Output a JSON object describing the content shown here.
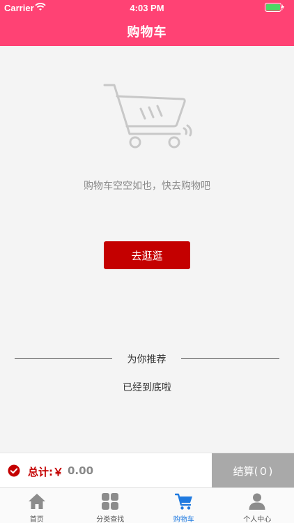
{
  "status_bar": {
    "carrier": "Carrier",
    "time": "4:03 PM"
  },
  "header": {
    "title": "购物车"
  },
  "empty_state": {
    "message": "购物车空空如也，快去购物吧",
    "button_label": "去逛逛"
  },
  "recommend": {
    "title": "为你推荐",
    "end_text": "已经到底啦"
  },
  "checkout": {
    "total_label": "总计:￥",
    "total_value": "0.00",
    "button_label": "结算(０)"
  },
  "tabs": [
    {
      "label": "首页",
      "icon": "home-icon"
    },
    {
      "label": "分类查找",
      "icon": "grid-icon"
    },
    {
      "label": "购物车",
      "icon": "cart-icon",
      "active": true
    },
    {
      "label": "个人中心",
      "icon": "user-icon"
    }
  ],
  "colors": {
    "header": "#ff4274",
    "primary_red": "#c40000",
    "tab_active": "#1f7ae0",
    "checkout_disabled": "#a9a9a9"
  }
}
